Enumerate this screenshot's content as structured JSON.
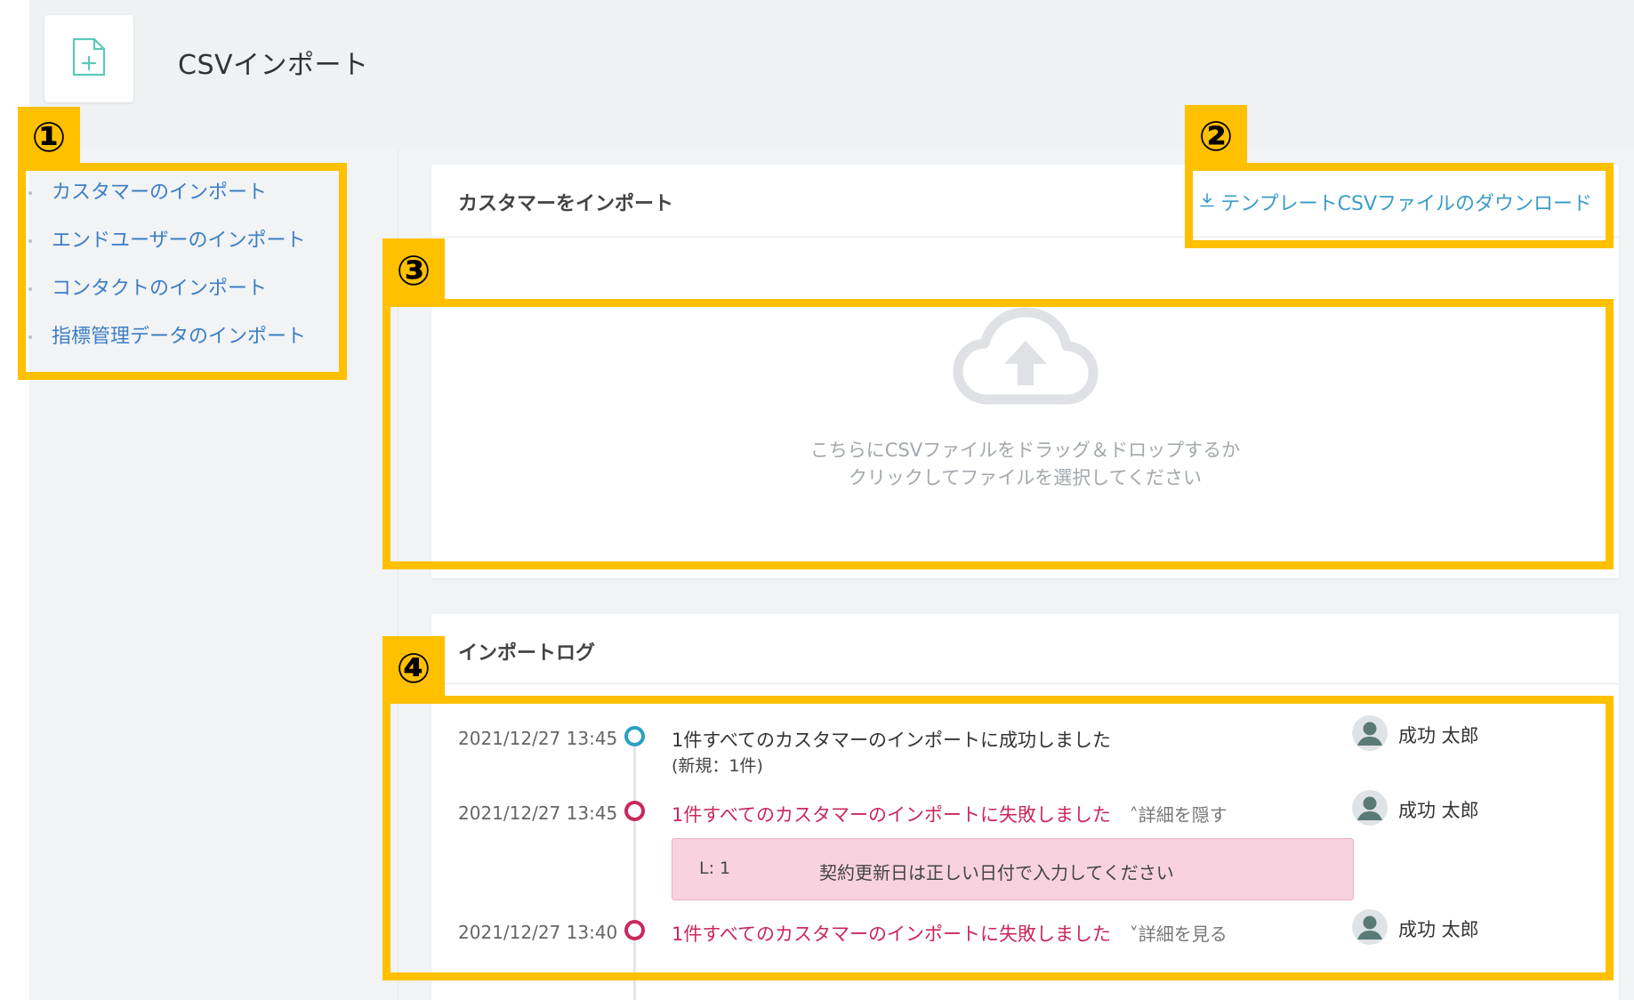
{
  "header": {
    "title": "CSVインポート",
    "icon": "file-add-icon"
  },
  "sidebar": {
    "items": [
      {
        "label": "カスタマーのインポート"
      },
      {
        "label": "エンドユーザーのインポート"
      },
      {
        "label": "コンタクトのインポート"
      },
      {
        "label": "指標管理データのインポート"
      }
    ]
  },
  "import_card": {
    "title": "カスタマーをインポート",
    "download_label": "テンプレートCSVファイルのダウンロード",
    "dropzone_line1": "こちらにCSVファイルをドラッグ＆ドロップするか",
    "dropzone_line2": "クリックしてファイルを選択してください"
  },
  "log": {
    "title": "インポートログ",
    "entries": [
      {
        "time": "2021/12/27 13:45",
        "status": "success",
        "message": "1件すべてのカスタマーのインポートに成功しました",
        "sub": "(新規：1件)",
        "user": "成功 太郎"
      },
      {
        "time": "2021/12/27 13:45",
        "status": "fail",
        "message": "1件すべてのカスタマーのインポートに失敗しました",
        "toggle": "詳細を隠す",
        "error_line": "L: 1",
        "error_message": "契約更新日は正しい日付で入力してください",
        "user": "成功 太郎"
      },
      {
        "time": "2021/12/27 13:40",
        "status": "fail",
        "message": "1件すべてのカスタマーのインポートに失敗しました",
        "toggle": "詳細を見る",
        "user": "成功 太郎"
      }
    ]
  },
  "annotations": [
    "①",
    "②",
    "③",
    "④"
  ],
  "colors": {
    "highlight": "#ffc000",
    "link": "#3d7ec5",
    "success": "#2aa0c4",
    "fail": "#c8285a",
    "error_bg": "#f8d3df"
  }
}
